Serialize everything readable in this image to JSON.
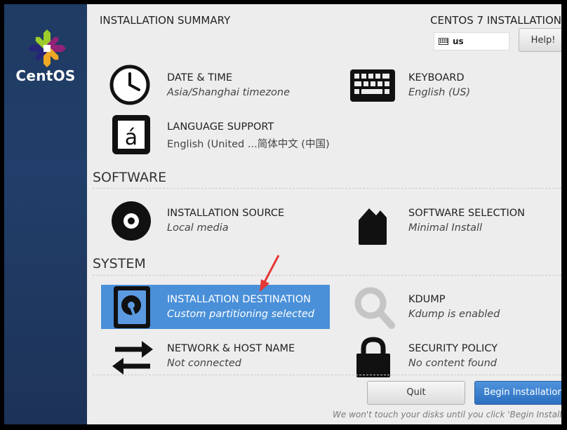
{
  "sidebar": {
    "brand": "CentOS",
    "logo_icon": "centos-logo-icon"
  },
  "header": {
    "title": "INSTALLATION SUMMARY",
    "product": "CENTOS 7 INSTALLATION",
    "keyboard_layout": "us",
    "help_label": "Help!"
  },
  "sections": {
    "software": "SOFTWARE",
    "system": "SYSTEM"
  },
  "spokes": {
    "datetime": {
      "title": "DATE & TIME",
      "status": "Asia/Shanghai timezone",
      "icon": "clock-icon"
    },
    "keyboard": {
      "title": "KEYBOARD",
      "status": "English (US)",
      "icon": "keyboard-icon"
    },
    "language": {
      "title": "LANGUAGE SUPPORT",
      "status": "English (United ...简体中文 (中国)",
      "icon": "language-icon"
    },
    "source": {
      "title": "INSTALLATION SOURCE",
      "status": "Local media",
      "icon": "disc-icon"
    },
    "selection": {
      "title": "SOFTWARE SELECTION",
      "status": "Minimal Install",
      "icon": "package-icon"
    },
    "destination": {
      "title": "INSTALLATION DESTINATION",
      "status": "Custom partitioning selected",
      "icon": "harddisk-icon"
    },
    "kdump": {
      "title": "KDUMP",
      "status": "Kdump is enabled",
      "icon": "magnifier-icon"
    },
    "network": {
      "title": "NETWORK & HOST NAME",
      "status": "Not connected",
      "icon": "network-arrows-icon"
    },
    "security": {
      "title": "SECURITY POLICY",
      "status": "No content found",
      "icon": "lock-icon"
    }
  },
  "footer": {
    "quit_label": "Quit",
    "begin_label": "Begin Installation",
    "note": "We won't touch your disks until you click 'Begin Installation'."
  },
  "colors": {
    "selected": "#4a90d9",
    "sidebar": "#213f6a",
    "primary_button": "#3a7fcf",
    "annotation_arrow": "#e53935"
  }
}
